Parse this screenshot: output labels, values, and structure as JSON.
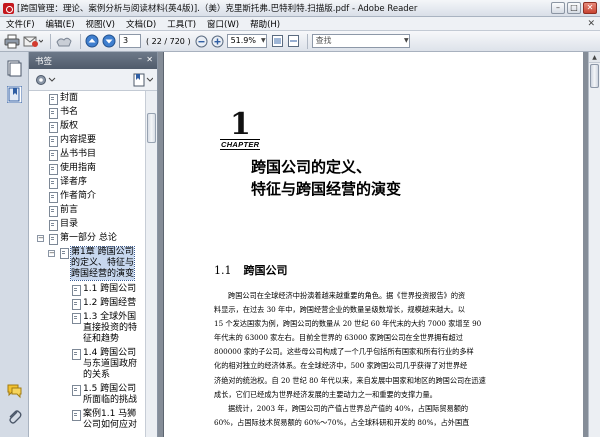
{
  "window": {
    "title": "[跨国管理：理论、案例分析与阅读材料(英4版)].（美）克里斯托弗.巴特利特.扫描版.pdf - Adobe Reader",
    "controls": {
      "minimize": "–",
      "maximize": "□",
      "close": "✕"
    }
  },
  "menu": {
    "items": [
      "文件(F)",
      "编辑(E)",
      "视图(V)",
      "文档(D)",
      "工具(T)",
      "窗口(W)",
      "帮助(H)"
    ],
    "close_glyph": "✕"
  },
  "toolbar": {
    "page_number": "3",
    "page_count": "( 22 / 720 )",
    "zoom": "51.9%",
    "search_placeholder": "查找"
  },
  "nav": {
    "header": "书签",
    "header_min": "–",
    "header_close": "✕",
    "bookmarks": [
      {
        "label": "封面"
      },
      {
        "label": "书名"
      },
      {
        "label": "版权"
      },
      {
        "label": "内容提要"
      },
      {
        "label": "丛书书目"
      },
      {
        "label": "使用指南"
      },
      {
        "label": "译者序"
      },
      {
        "label": "作者简介"
      },
      {
        "label": "前言"
      },
      {
        "label": "目录"
      },
      {
        "label": "第一部分  总论"
      }
    ],
    "selected": [
      "第1章  跨国公司",
      "的定义、特征与",
      "跨国经营的演变"
    ],
    "children": [
      {
        "lines": [
          "1.1  跨国公司"
        ]
      },
      {
        "lines": [
          "1.2  跨国经营"
        ]
      },
      {
        "lines": [
          "1.3  全球外国",
          "直接投资的特",
          "征和趋势"
        ]
      },
      {
        "lines": [
          "1.4  跨国公司",
          "与东道国政府",
          "的关系"
        ]
      },
      {
        "lines": [
          "1.5  跨国公司",
          "所面临的挑战"
        ]
      },
      {
        "lines": [
          "案例1.1  马狮",
          "公司如何应对"
        ]
      }
    ]
  },
  "document": {
    "chapter_number": "1",
    "chapter_word": "CHAPTER",
    "chapter_title": [
      "跨国公司的定义、",
      "特征与跨国经营的演变"
    ],
    "section_number": "1.1",
    "section_title": "跨国公司",
    "paragraph1": [
      "跨国公司在全球经济中扮演着越来越重要的角色。据《世界投资报告》的资",
      "料显示，在过去 30 年中，跨国经营企业的数量呈级数增长，规模越来越大。以",
      "15 个发达国家为例，跨国公司的数量从 20 世纪 60 年代末的大约 7000 家增至 90",
      "年代末的 63000 家左右。目前全世界的 63000 家跨国公司在全世界拥有超过",
      "800000 家的子公司。这些母公司构成了一个几乎包括所有国家和所有行业的多样",
      "化的相对独立的经济体系。在全球经济中，500 家跨国公司几乎获得了对世界经",
      "济绝对的统治权。自 20 世纪 80 年代以来，来自发展中国家和地区的跨国公司在迅速",
      "成长，它们已经成为世界经济发展的主要动力之一和重要的支撑力量。"
    ],
    "paragraph2": [
      "据统计，2003 年，跨国公司的产值占世界总产值的 40%，占国际贸易额的",
      "60%，占国际技术贸易额的 60%～70%，占全球科研和开发的 80%，占外国直"
    ]
  }
}
